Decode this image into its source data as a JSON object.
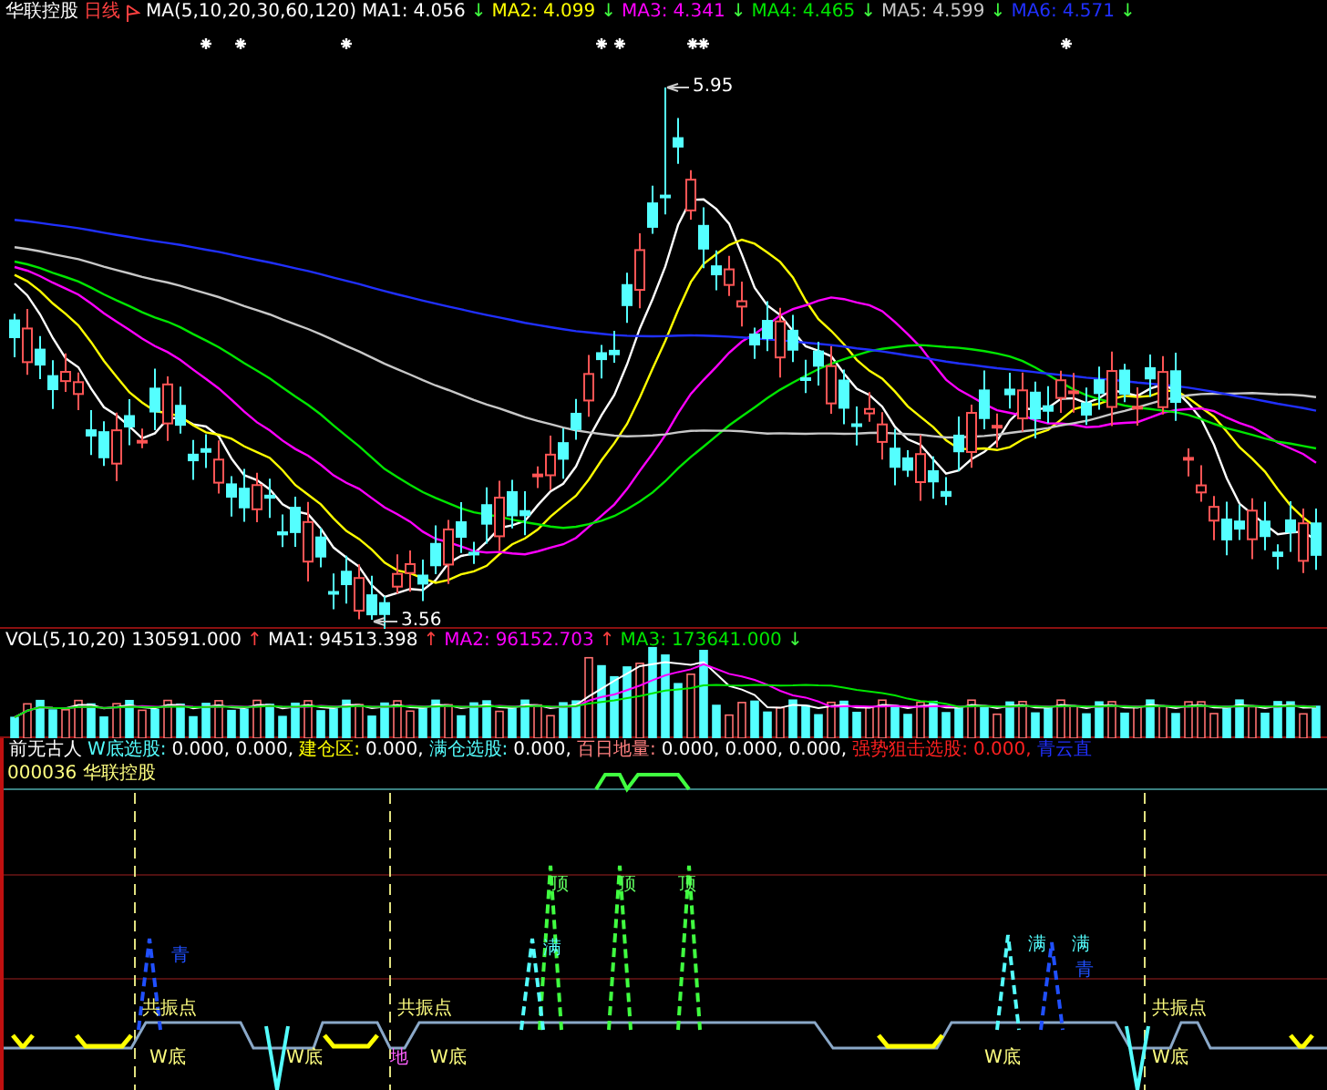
{
  "main_panel": {
    "stock_name": "华联控股",
    "period": "日线",
    "indicator": "MA(5,10,20,30,60,120)",
    "high_label": "5.95",
    "low_label": "3.56",
    "readings": [
      {
        "label": "MA1:",
        "value": "4.056",
        "arrow": {
          "text": "↓",
          "color": "#40ff40"
        },
        "color": "#ffffff"
      },
      {
        "label": "MA2:",
        "value": "4.099",
        "arrow": {
          "text": "↓",
          "color": "#40ff40"
        },
        "color": "#ffff00"
      },
      {
        "label": "MA3:",
        "value": "4.341",
        "arrow": {
          "text": "↓",
          "color": "#40ff40"
        },
        "color": "#ff00ff"
      },
      {
        "label": "MA4:",
        "value": "4.465",
        "arrow": {
          "text": "↓",
          "color": "#40ff40"
        },
        "color": "#00e600"
      },
      {
        "label": "MA5:",
        "value": "4.599",
        "arrow": {
          "text": "↓",
          "color": "#40ff40"
        },
        "color": "#c8c8c8"
      },
      {
        "label": "MA6:",
        "value": "4.571",
        "arrow": {
          "text": "↓",
          "color": "#40ff40"
        },
        "color": "#2030ff"
      }
    ]
  },
  "volume_panel": {
    "indicator": "VOL(5,10,20)",
    "value": "130591.000",
    "arrow": {
      "text": "↑",
      "color": "#ff4040"
    },
    "readings": [
      {
        "label": "MA1:",
        "value": "94513.398",
        "arrow": {
          "text": "↑",
          "color": "#ff4040"
        },
        "color": "#ffffff"
      },
      {
        "label": "MA2:",
        "value": "96152.703",
        "arrow": {
          "text": "↑",
          "color": "#ff4040"
        },
        "color": "#ff00ff"
      },
      {
        "label": "MA3:",
        "value": "173641.000",
        "arrow": {
          "text": "↓",
          "color": "#40ff40"
        },
        "color": "#00e600"
      }
    ]
  },
  "signal_panel": {
    "legend": [
      {
        "text": "前无古人",
        "color": "#ffffff"
      },
      {
        "text": "W底选股:",
        "color": "#54ffff"
      },
      {
        "text": "0.000, 0.000,",
        "color": "#ffffff"
      },
      {
        "text": "建仓区:",
        "color": "#ffff00"
      },
      {
        "text": "0.000,",
        "color": "#ffffff"
      },
      {
        "text": "满仓选股:",
        "color": "#54ffff"
      },
      {
        "text": "0.000,",
        "color": "#ffffff"
      },
      {
        "text": "百日地量:",
        "color": "#ff8080"
      },
      {
        "text": "0.000, 0.000, 0.000,",
        "color": "#ffffff"
      },
      {
        "text": "强势狙击选股:",
        "color": "#ff2020"
      },
      {
        "text": "0.000,",
        "color": "#ff2020"
      },
      {
        "text": "青云直",
        "color": "#2030ff"
      }
    ],
    "code_line": "000036 华联控股",
    "labels": [
      {
        "text": "顶",
        "color": "#60ff60"
      },
      {
        "text": "顶",
        "color": "#60ff60"
      },
      {
        "text": "顶",
        "color": "#60ff60"
      },
      {
        "text": "青",
        "color": "#2050ff"
      },
      {
        "text": "满",
        "color": "#54ffff"
      },
      {
        "text": "满",
        "color": "#54ffff"
      },
      {
        "text": "满",
        "color": "#54ffff"
      },
      {
        "text": "青",
        "color": "#2050ff"
      },
      {
        "text": "共振点",
        "color": "#ffff80"
      },
      {
        "text": "共振点",
        "color": "#ffff80"
      },
      {
        "text": "共振点",
        "color": "#ffff80"
      },
      {
        "text": "W底",
        "color": "#ffff80"
      },
      {
        "text": "W底",
        "color": "#ffff80"
      },
      {
        "text": "地",
        "color": "#ff60ff"
      },
      {
        "text": "W底",
        "color": "#ffff80"
      },
      {
        "text": "W底",
        "color": "#ffff80"
      },
      {
        "text": "W底",
        "color": "#ffff80"
      }
    ]
  }
}
